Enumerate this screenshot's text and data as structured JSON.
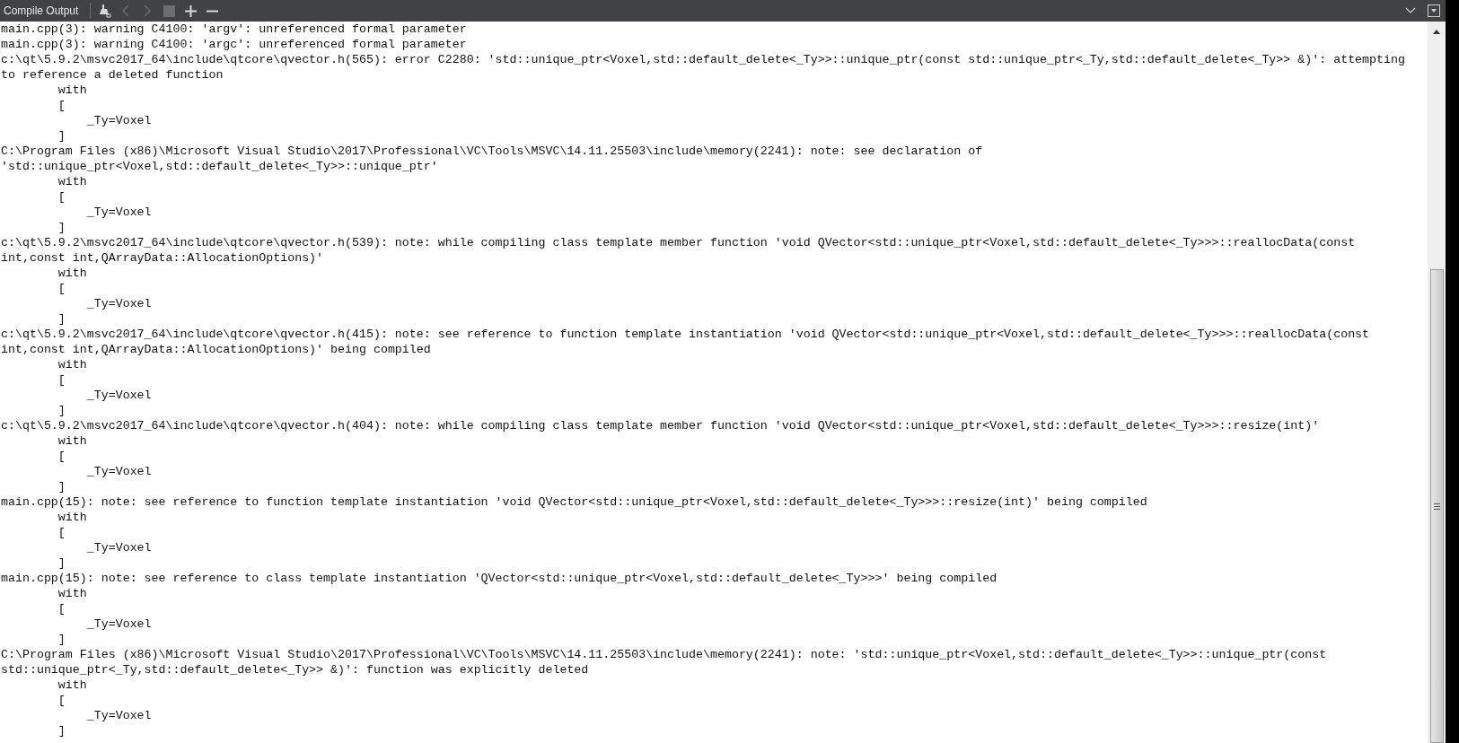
{
  "panel": {
    "title": "Compile Output"
  },
  "toolbar": [
    {
      "kind": "clean",
      "disabled": false
    },
    {
      "kind": "prev",
      "disabled": true
    },
    {
      "kind": "next",
      "disabled": true
    },
    {
      "kind": "stop",
      "disabled": true
    },
    {
      "kind": "zoom-in",
      "disabled": false
    },
    {
      "kind": "zoom-out",
      "disabled": false
    }
  ],
  "output_lines": [
    "main.cpp(3): warning C4100: 'argv': unreferenced formal parameter",
    "main.cpp(3): warning C4100: 'argc': unreferenced formal parameter",
    "c:\\qt\\5.9.2\\msvc2017_64\\include\\qtcore\\qvector.h(565): error C2280: 'std::unique_ptr<Voxel,std::default_delete<_Ty>>::unique_ptr(const std::unique_ptr<_Ty,std::default_delete<_Ty>> &)': attempting",
    "to reference a deleted function",
    "        with",
    "        [",
    "            _Ty=Voxel",
    "        ]",
    "C:\\Program Files (x86)\\Microsoft Visual Studio\\2017\\Professional\\VC\\Tools\\MSVC\\14.11.25503\\include\\memory(2241): note: see declaration of",
    "'std::unique_ptr<Voxel,std::default_delete<_Ty>>::unique_ptr'",
    "        with",
    "        [",
    "            _Ty=Voxel",
    "        ]",
    "c:\\qt\\5.9.2\\msvc2017_64\\include\\qtcore\\qvector.h(539): note: while compiling class template member function 'void QVector<std::unique_ptr<Voxel,std::default_delete<_Ty>>>::reallocData(const",
    "int,const int,QArrayData::AllocationOptions)'",
    "        with",
    "        [",
    "            _Ty=Voxel",
    "        ]",
    "c:\\qt\\5.9.2\\msvc2017_64\\include\\qtcore\\qvector.h(415): note: see reference to function template instantiation 'void QVector<std::unique_ptr<Voxel,std::default_delete<_Ty>>>::reallocData(const",
    "int,const int,QArrayData::AllocationOptions)' being compiled",
    "        with",
    "        [",
    "            _Ty=Voxel",
    "        ]",
    "c:\\qt\\5.9.2\\msvc2017_64\\include\\qtcore\\qvector.h(404): note: while compiling class template member function 'void QVector<std::unique_ptr<Voxel,std::default_delete<_Ty>>>::resize(int)'",
    "        with",
    "        [",
    "            _Ty=Voxel",
    "        ]",
    "main.cpp(15): note: see reference to function template instantiation 'void QVector<std::unique_ptr<Voxel,std::default_delete<_Ty>>>::resize(int)' being compiled",
    "        with",
    "        [",
    "            _Ty=Voxel",
    "        ]",
    "main.cpp(15): note: see reference to class template instantiation 'QVector<std::unique_ptr<Voxel,std::default_delete<_Ty>>>' being compiled",
    "        with",
    "        [",
    "            _Ty=Voxel",
    "        ]",
    "C:\\Program Files (x86)\\Microsoft Visual Studio\\2017\\Professional\\VC\\Tools\\MSVC\\14.11.25503\\include\\memory(2241): note: 'std::unique_ptr<Voxel,std::default_delete<_Ty>>::unique_ptr(const",
    "std::unique_ptr<_Ty,std::default_delete<_Ty>> &)': function was explicitly deleted",
    "        with",
    "        [",
    "            _Ty=Voxel",
    "        ]"
  ]
}
